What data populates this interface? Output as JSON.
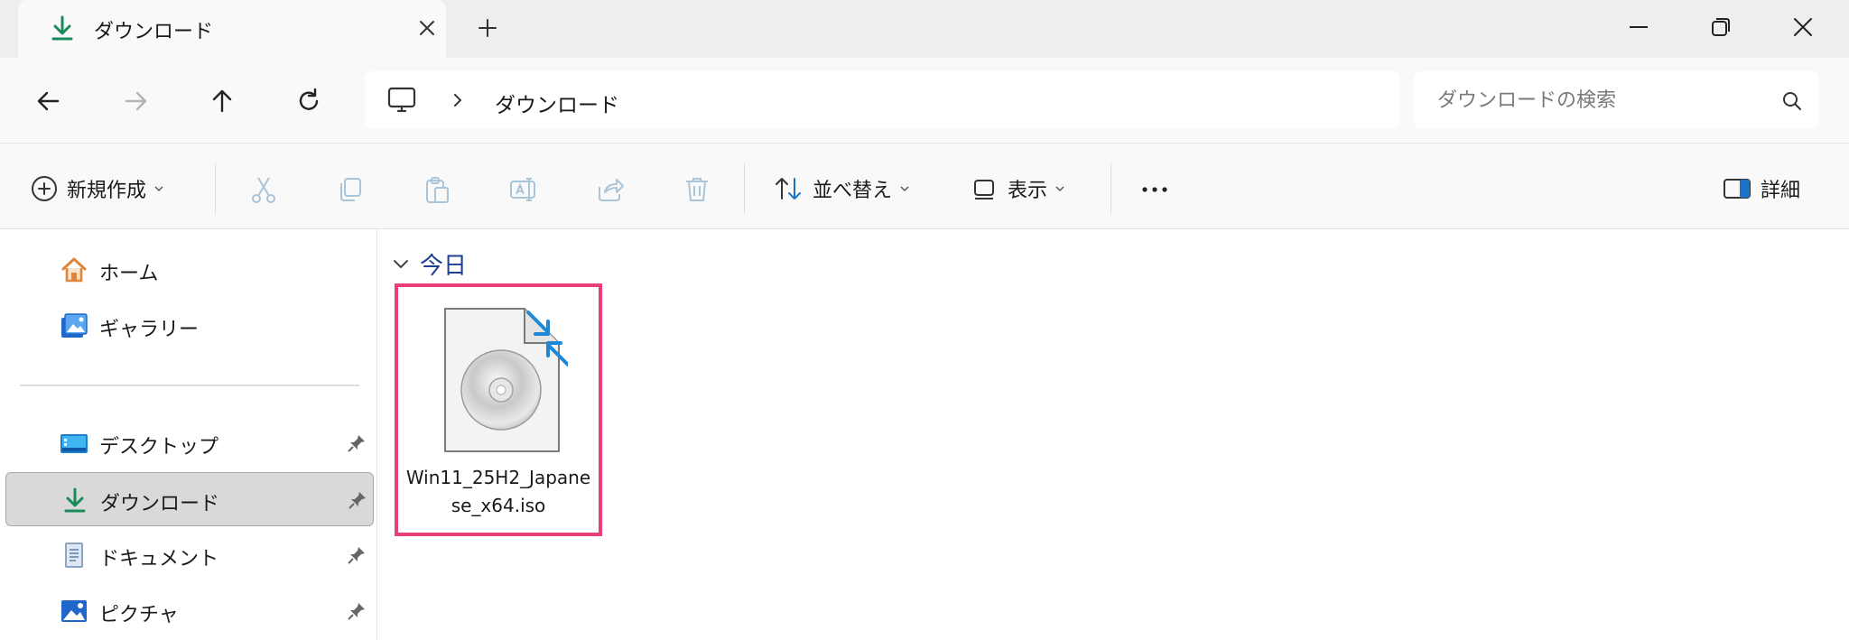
{
  "window": {
    "tab_title": "ダウンロード",
    "accent_color": "#1b8a5a"
  },
  "address_bar": {
    "crumb": "ダウンロード",
    "search_placeholder": "ダウンロードの検索"
  },
  "command_bar": {
    "new_label": "新規作成",
    "sort_label": "並べ替え",
    "view_label": "表示",
    "details_label": "詳細"
  },
  "sidebar": {
    "items": [
      {
        "label": "ホーム",
        "icon": "home-icon",
        "pinned": false,
        "active": false
      },
      {
        "label": "ギャラリー",
        "icon": "gallery-icon",
        "pinned": false,
        "active": false
      },
      {
        "label": "デスクトップ",
        "icon": "desktop-icon",
        "pinned": true,
        "active": false
      },
      {
        "label": "ダウンロード",
        "icon": "download-icon",
        "pinned": true,
        "active": true
      },
      {
        "label": "ドキュメント",
        "icon": "documents-icon",
        "pinned": true,
        "active": false
      },
      {
        "label": "ピクチャ",
        "icon": "pictures-icon",
        "pinned": true,
        "active": false
      }
    ]
  },
  "content": {
    "group_title": "今日",
    "files": [
      {
        "name": "Win11_25H2_Japanese_x64.iso",
        "icon": "disc-image-icon",
        "highlight_color": "#ea3f79"
      }
    ]
  }
}
